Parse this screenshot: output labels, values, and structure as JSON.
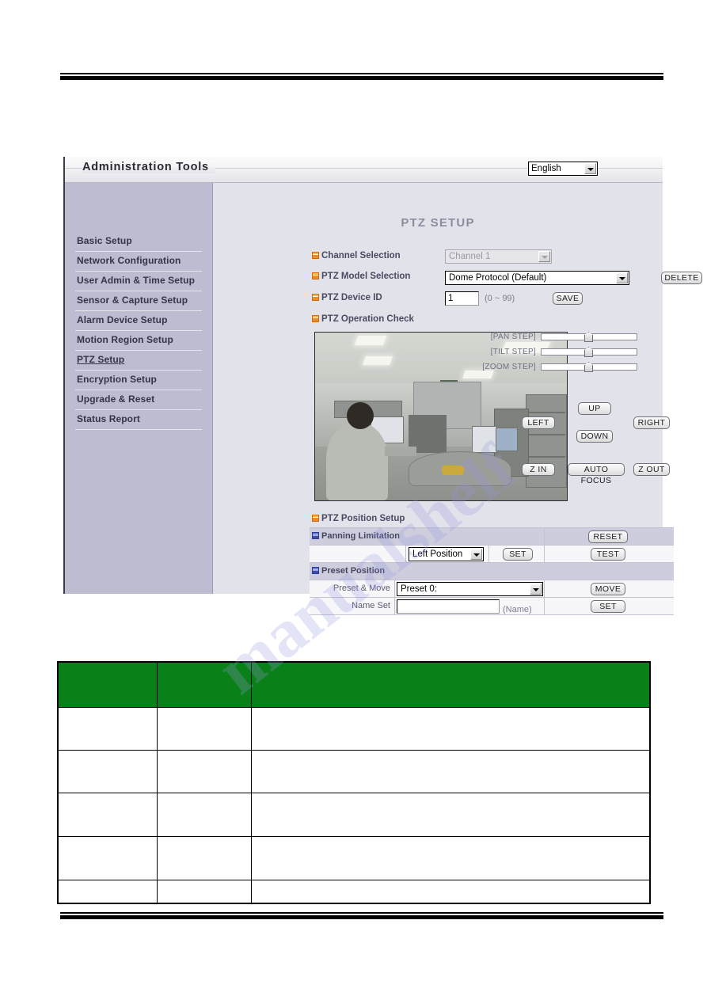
{
  "window": {
    "title": "Administration Tools",
    "language": "English"
  },
  "sidebar": {
    "items": [
      {
        "label": "Basic Setup",
        "active": false
      },
      {
        "label": "Network Configuration",
        "active": false
      },
      {
        "label": "User Admin & Time Setup",
        "active": false
      },
      {
        "label": "Sensor & Capture Setup",
        "active": false
      },
      {
        "label": "Alarm Device Setup",
        "active": false
      },
      {
        "label": "Motion Region Setup",
        "active": false
      },
      {
        "label": "PTZ Setup",
        "active": true
      },
      {
        "label": "Encryption Setup",
        "active": false
      },
      {
        "label": "Upgrade & Reset",
        "active": false
      },
      {
        "label": "Status Report",
        "active": false
      }
    ]
  },
  "main": {
    "page_title": "PTZ SETUP",
    "channel_selection": {
      "label": "Channel Selection",
      "value": "Channel 1",
      "disabled": true
    },
    "ptz_model_selection": {
      "label": "PTZ Model Selection",
      "value": "Dome Protocol (Default)",
      "delete_label": "DELETE"
    },
    "ptz_device_id": {
      "label": "PTZ Device ID",
      "value": "1",
      "hint": "(0 ~ 99)",
      "save_label": "SAVE"
    },
    "ptz_operation_check": {
      "label": "PTZ Operation Check",
      "sliders": [
        {
          "label": "[PAN STEP]",
          "percent": 49
        },
        {
          "label": "[TILT STEP]",
          "percent": 49
        },
        {
          "label": "[ZOOM STEP]",
          "percent": 49
        }
      ],
      "buttons": {
        "up": "UP",
        "down": "DOWN",
        "left": "LEFT",
        "right": "RIGHT",
        "zoom_in": "Z IN",
        "auto_focus": "AUTO FOCUS",
        "zoom_out": "Z OUT"
      }
    },
    "ptz_position_setup": {
      "label": "PTZ Position Setup",
      "panning_limitation": {
        "label": "Panning Limitation",
        "reset_label": "RESET",
        "value": "Left Position",
        "set_label": "SET",
        "test_label": "TEST"
      },
      "preset_position": {
        "label": "Preset Position",
        "preset_move_label": "Preset & Move",
        "preset_value": "Preset 0:",
        "move_label": "MOVE",
        "name_set_label": "Name Set",
        "name_value": "",
        "name_hint": "(Name)",
        "set_label": "SET"
      }
    }
  },
  "colors": {
    "table_header_green": "#0a8018",
    "sidebar": "#bdbdd2",
    "content_bg": "#e2e2ea",
    "accent_orange": "#f08a22",
    "accent_blue": "#3c4fae"
  },
  "watermark": {
    "text": "manualshelf"
  },
  "bottom_table": {
    "columns": 3,
    "header_cells": [
      "",
      "",
      ""
    ],
    "rows": [
      [
        "",
        "",
        ""
      ],
      [
        "",
        "",
        ""
      ],
      [
        "",
        "",
        ""
      ],
      [
        "",
        "",
        ""
      ],
      [
        "",
        "",
        ""
      ]
    ]
  }
}
